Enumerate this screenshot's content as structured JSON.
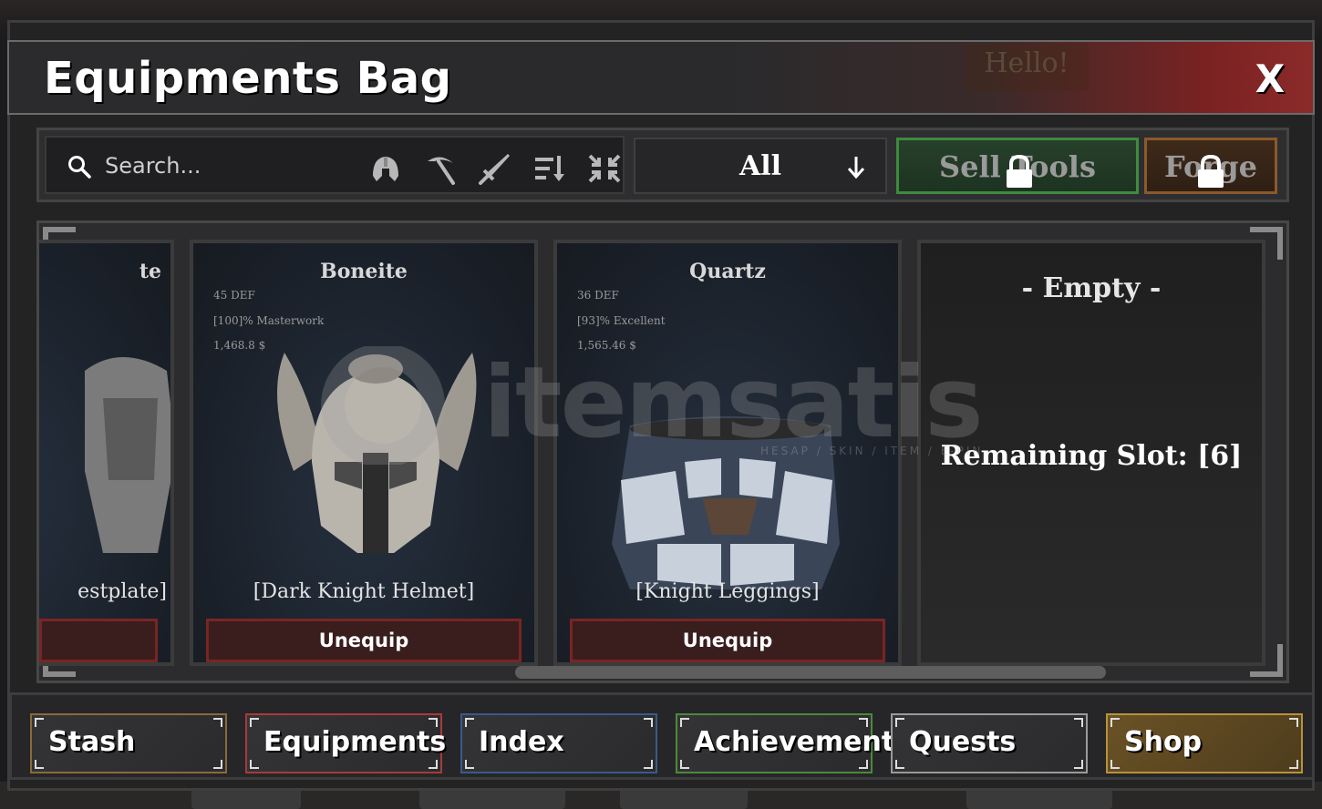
{
  "background": {
    "hello_text": "Hello!"
  },
  "header": {
    "title": "Equipments Bag",
    "close_label": "X"
  },
  "toolbar": {
    "search_placeholder": "Search...",
    "filter_icons": [
      "helmet-icon",
      "pickaxe-icon",
      "sword-icon",
      "sort-icon",
      "collapse-icon"
    ],
    "dropdown_value": "All",
    "sell_tools_label": "Sell Tools",
    "forge_label": "Forge"
  },
  "items": {
    "cards": [
      {
        "name": "te",
        "item_title": "estplate]",
        "partial": true
      },
      {
        "name": "Boneite",
        "stats": [
          "45 DEF",
          "[100]% Masterwork",
          "1,468.8 $"
        ],
        "item_title": "[Dark Knight Helmet]",
        "button": "Unequip"
      },
      {
        "name": "Quartz",
        "stats": [
          "36 DEF",
          "[93]% Excellent",
          "1,565.46 $"
        ],
        "item_title": "[Knight Leggings]",
        "button": "Unequip"
      }
    ],
    "empty": {
      "title": "- Empty -",
      "remaining": "Remaining Slot: [6]"
    }
  },
  "watermark": {
    "text": "itemsatis",
    "sub": "HESAP / SKIN / ITEM / E-PIN"
  },
  "nav": [
    {
      "label": "Stash",
      "color": "#8a6a3a"
    },
    {
      "label": "Equipments",
      "color": "#a83a3a"
    },
    {
      "label": "Index",
      "color": "#3a5a8a"
    },
    {
      "label": "Achievements",
      "color": "#4a8a3a"
    },
    {
      "label": "Quests",
      "color": "#9a9a9a"
    },
    {
      "label": "Shop",
      "color": "#b8923a"
    }
  ]
}
